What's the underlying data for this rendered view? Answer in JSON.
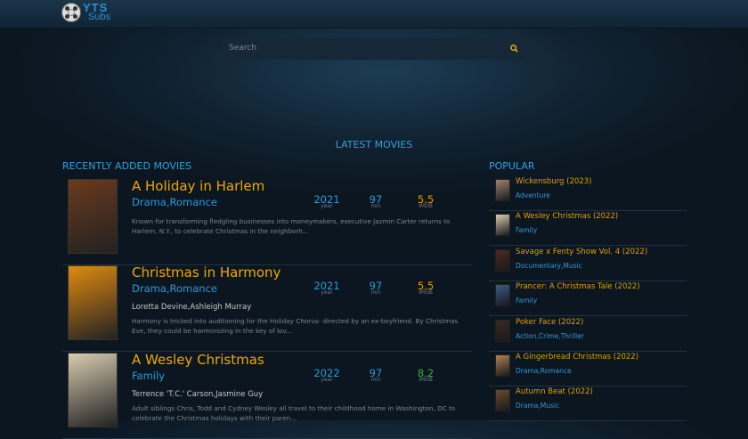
{
  "header": {
    "logo_text": "YTS Subs"
  },
  "search": {
    "placeholder": "Search"
  },
  "sections": {
    "latest": "LATEST MOVIES",
    "recent": "RECENTLY ADDED MOVIES",
    "popular": "POPULAR"
  },
  "stat_labels": {
    "year": "year",
    "min": "min",
    "imdb": "IMDB"
  },
  "movies": [
    {
      "title": "A Holiday in Harlem",
      "genre": "Drama,Romance",
      "year": "2021",
      "min": "97",
      "imdb": "5.5",
      "cast": "",
      "desc": "Known for transforming fledgling businesses into moneymakers, executive Jazmin Carter returns to Harlem, N.Y., to celebrate Christmas in the neighborh...",
      "poster_color": "#6b3a1e"
    },
    {
      "title": "Christmas in Harmony",
      "genre": "Drama,Romance",
      "year": "2021",
      "min": "97",
      "imdb": "5.5",
      "cast": "Loretta Devine,Ashleigh Murray",
      "desc": "Harmony is tricked into auditioning for the Holiday Chorus- directed by an ex-boyfriend. By Christmas Eve, they could be harmonizing in the key of lov...",
      "poster_color": "#e08a10"
    },
    {
      "title": "A Wesley Christmas",
      "genre": "Family",
      "year": "2022",
      "min": "97",
      "imdb": "8.2",
      "cast": "Terrence 'T.C.' Carson,Jasmine Guy",
      "desc": "Adult siblings Chris, Todd and Cydney Wesley all travel to their childhood home in Washington, DC to celebrate the Christmas holidays with their paren...",
      "poster_color": "#d8cbb0"
    }
  ],
  "popular": [
    {
      "title": "Wickensburg (2023)",
      "genre": "Adventure",
      "color": "#a08070"
    },
    {
      "title": "A Wesley Christmas (2022)",
      "genre": "Family",
      "color": "#d8cbb0"
    },
    {
      "title": "Savage x Fenty Show Vol. 4 (2022)",
      "genre": "Documentary,Music",
      "color": "#4a2a20"
    },
    {
      "title": "Prancer: A Christmas Tale (2022)",
      "genre": "Family",
      "color": "#3a5a8a"
    },
    {
      "title": "Poker Face (2022)",
      "genre": "Action,Crime,Thriller",
      "color": "#3a2a22"
    },
    {
      "title": "A Gingerbread Christmas (2022)",
      "genre": "Drama,Romance",
      "color": "#b08050"
    },
    {
      "title": "Autumn Beat (2022)",
      "genre": "Drama,Music",
      "color": "#6a4a30"
    }
  ]
}
